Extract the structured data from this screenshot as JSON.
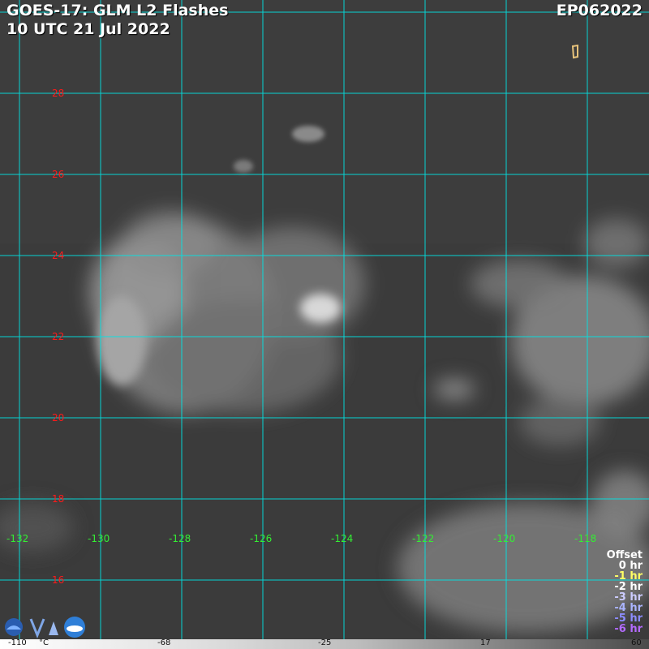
{
  "header": {
    "title": "GOES-17: GLM L2 Flashes",
    "subtitle": "10 UTC 21 Jul 2022",
    "storm_id": "EP062022"
  },
  "latitude_labels": [
    "28",
    "26",
    "24",
    "22",
    "20",
    "18",
    "16"
  ],
  "longitude_labels": [
    "-132",
    "-130",
    "-128",
    "-126",
    "-124",
    "-122",
    "-120",
    "-118"
  ],
  "legend": {
    "title": "Offset",
    "items": [
      {
        "label": "0 hr",
        "color": "#ffffff"
      },
      {
        "label": "-1 hr",
        "color": "#ffff66"
      },
      {
        "label": "-2 hr",
        "color": "#ffffff"
      },
      {
        "label": "-3 hr",
        "color": "#ccccff"
      },
      {
        "label": "-4 hr",
        "color": "#aab4ff"
      },
      {
        "label": "-5 hr",
        "color": "#8c8cff"
      },
      {
        "label": "-6 hr",
        "color": "#b36bff"
      }
    ]
  },
  "colorbar": {
    "labels": [
      "-110",
      "°C",
      "-68",
      "-25",
      "17",
      "60"
    ]
  },
  "colors": {
    "grid": "#00e5e5",
    "lat_label": "#ff1a1a",
    "lon_label": "#33ee33",
    "background": "#3a3a3a"
  },
  "icons": [
    "noaa-logo-icon",
    "nesdis-logo-icon",
    "rammb-logo-icon"
  ]
}
